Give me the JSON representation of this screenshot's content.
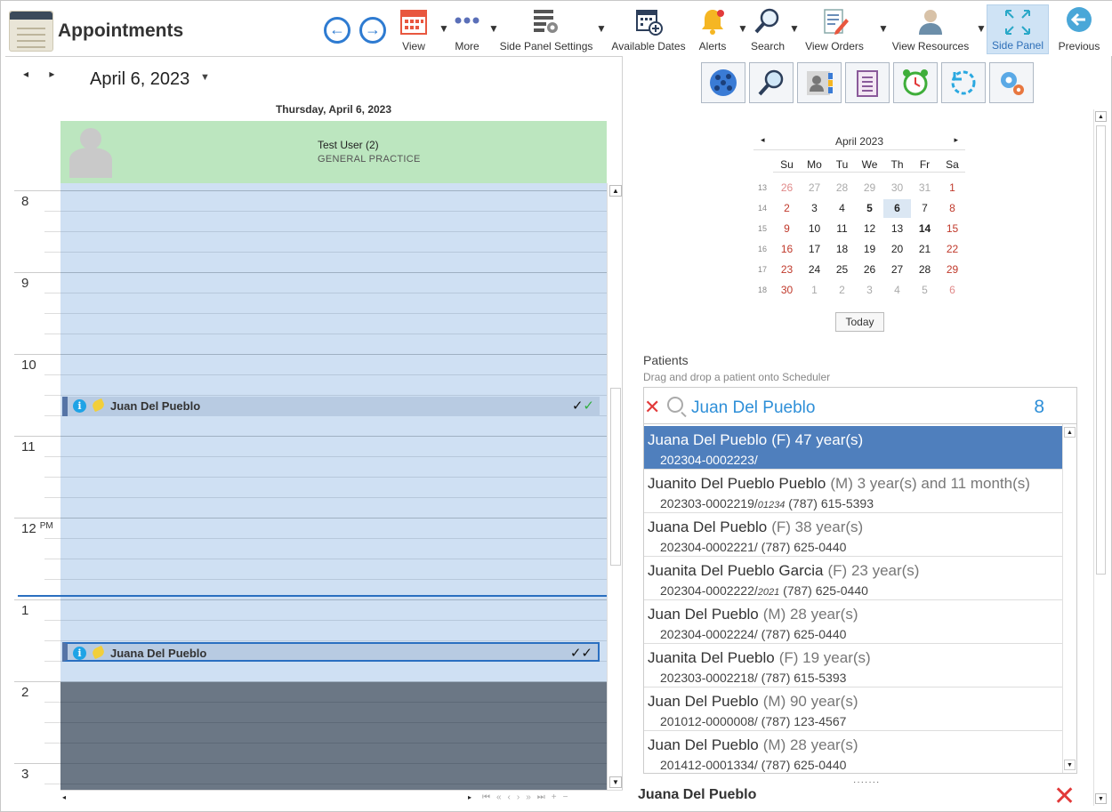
{
  "app": {
    "title": "Appointments"
  },
  "toolbar": {
    "view": "View",
    "more": "More",
    "side_panel_settings": "Side Panel Settings",
    "available_dates": "Available Dates",
    "alerts": "Alerts",
    "search": "Search",
    "view_orders": "View Orders",
    "view_resources": "View Resources",
    "side_panel": "Side Panel",
    "previous": "Previous"
  },
  "scheduler": {
    "date": "April 6, 2023",
    "day_header": "Thursday, April 6, 2023",
    "resource_name": "Test User (2)",
    "resource_spec": "GENERAL PRACTICE",
    "hours": [
      "8",
      "9",
      "10",
      "11",
      "12",
      "1",
      "2",
      "3"
    ],
    "pm_label": "PM",
    "appointments": [
      {
        "name": "Juan Del Pueblo"
      },
      {
        "name": "Juana Del Pueblo"
      }
    ]
  },
  "calendar": {
    "title": "April 2023",
    "dows": [
      "Su",
      "Mo",
      "Tu",
      "We",
      "Th",
      "Fr",
      "Sa"
    ],
    "weeks": [
      "13",
      "14",
      "15",
      "16",
      "17",
      "18"
    ],
    "days": [
      [
        "26",
        "27",
        "28",
        "29",
        "30",
        "31",
        "1"
      ],
      [
        "2",
        "3",
        "4",
        "5",
        "6",
        "7",
        "8"
      ],
      [
        "9",
        "10",
        "11",
        "12",
        "13",
        "14",
        "15"
      ],
      [
        "16",
        "17",
        "18",
        "19",
        "20",
        "21",
        "22"
      ],
      [
        "23",
        "24",
        "25",
        "26",
        "27",
        "28",
        "29"
      ],
      [
        "30",
        "1",
        "2",
        "3",
        "4",
        "5",
        "6"
      ]
    ],
    "today_label": "Today"
  },
  "patients": {
    "title": "Patients",
    "subtitle": "Drag and drop a patient onto Scheduler",
    "search_value": "Juan Del Pueblo",
    "count": "8",
    "items": [
      {
        "name": "Juana Del Pueblo",
        "meta": "(F) 47 year(s)",
        "id": "202304-0002223/",
        "code": "",
        "phone": ""
      },
      {
        "name": "Juanito Del Pueblo Pueblo",
        "meta": "(M) 3 year(s) and 11 month(s)",
        "id": "202303-0002219/",
        "code": "01234",
        "phone": " (787) 615-5393"
      },
      {
        "name": "Juana Del Pueblo",
        "meta": "(F) 38 year(s)",
        "id": "202304-0002221/",
        "code": "",
        "phone": " (787) 625-0440"
      },
      {
        "name": "Juanita Del Pueblo Garcia",
        "meta": "(F) 23 year(s)",
        "id": "202304-0002222/",
        "code": "2021",
        "phone": " (787) 625-0440"
      },
      {
        "name": "Juan Del Pueblo",
        "meta": "(M) 28 year(s)",
        "id": "202304-0002224/",
        "code": "",
        "phone": " (787) 625-0440"
      },
      {
        "name": "Juanita Del Pueblo",
        "meta": "(F) 19 year(s)",
        "id": "202303-0002218/",
        "code": "",
        "phone": " (787) 615-5393"
      },
      {
        "name": "Juan Del Pueblo",
        "meta": "(M) 90 year(s)",
        "id": "201012-0000008/",
        "code": "",
        "phone": " (787) 123-4567"
      },
      {
        "name": "Juan Del Pueblo",
        "meta": "(M) 28 year(s)",
        "id": "201412-0001334/",
        "code": "",
        "phone": " (787) 625-0440"
      }
    ],
    "selected_name": "Juana Del Pueblo"
  },
  "colors": {
    "accent": "#2e8fd8",
    "selected": "#4f7fbd",
    "resource": "#bce6bf",
    "slot": "#cfe0f3",
    "offhours": "#6b7785"
  }
}
